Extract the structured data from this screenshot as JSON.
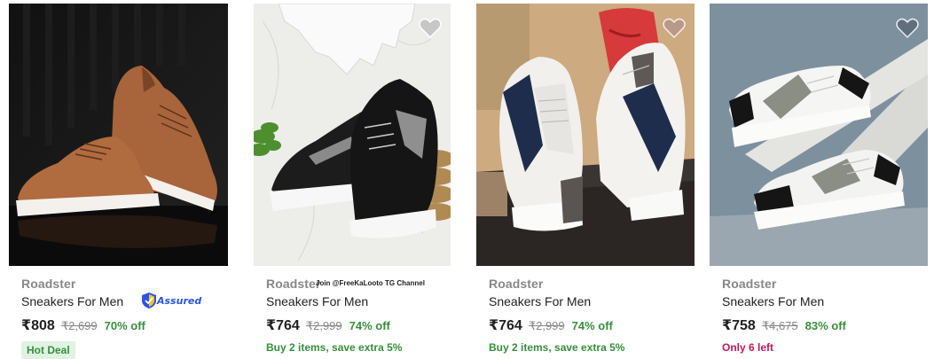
{
  "products": [
    {
      "brand": "Roadster",
      "title": "Sneakers For Men",
      "price": "₹808",
      "mrp": "₹2,699",
      "discount": "70% off",
      "badge": "Hot Deal",
      "assured_label": "Assured",
      "image_icon": "brown-leather-sneakers-image"
    },
    {
      "brand": "Roadster",
      "title": "Sneakers For Men",
      "price": "₹764",
      "mrp": "₹2,999",
      "discount": "74% off",
      "offer": "Buy 2 items, save extra 5%",
      "promo_text": "Join @FreeKaLooto TG Channel",
      "wishlist_icon": "heart-icon",
      "image_icon": "black-sneakers-image"
    },
    {
      "brand": "Roadster",
      "title": "Sneakers For Men",
      "price": "₹764",
      "mrp": "₹2,999",
      "discount": "74% off",
      "offer": "Buy 2 items, save extra 5%",
      "wishlist_icon": "heart-icon",
      "image_icon": "white-navy-sneakers-image"
    },
    {
      "brand": "Roadster",
      "title": "Sneakers For Men",
      "price": "₹758",
      "mrp": "₹4,675",
      "discount": "83% off",
      "stock_note": "Only 6 left",
      "wishlist_icon": "heart-icon",
      "image_icon": "white-black-grey-sneakers-image"
    }
  ],
  "colors": {
    "discount_green": "#388e3c",
    "stock_pink": "#c2185b",
    "assured_blue": "#2a55e5",
    "muted_grey": "#878787"
  }
}
